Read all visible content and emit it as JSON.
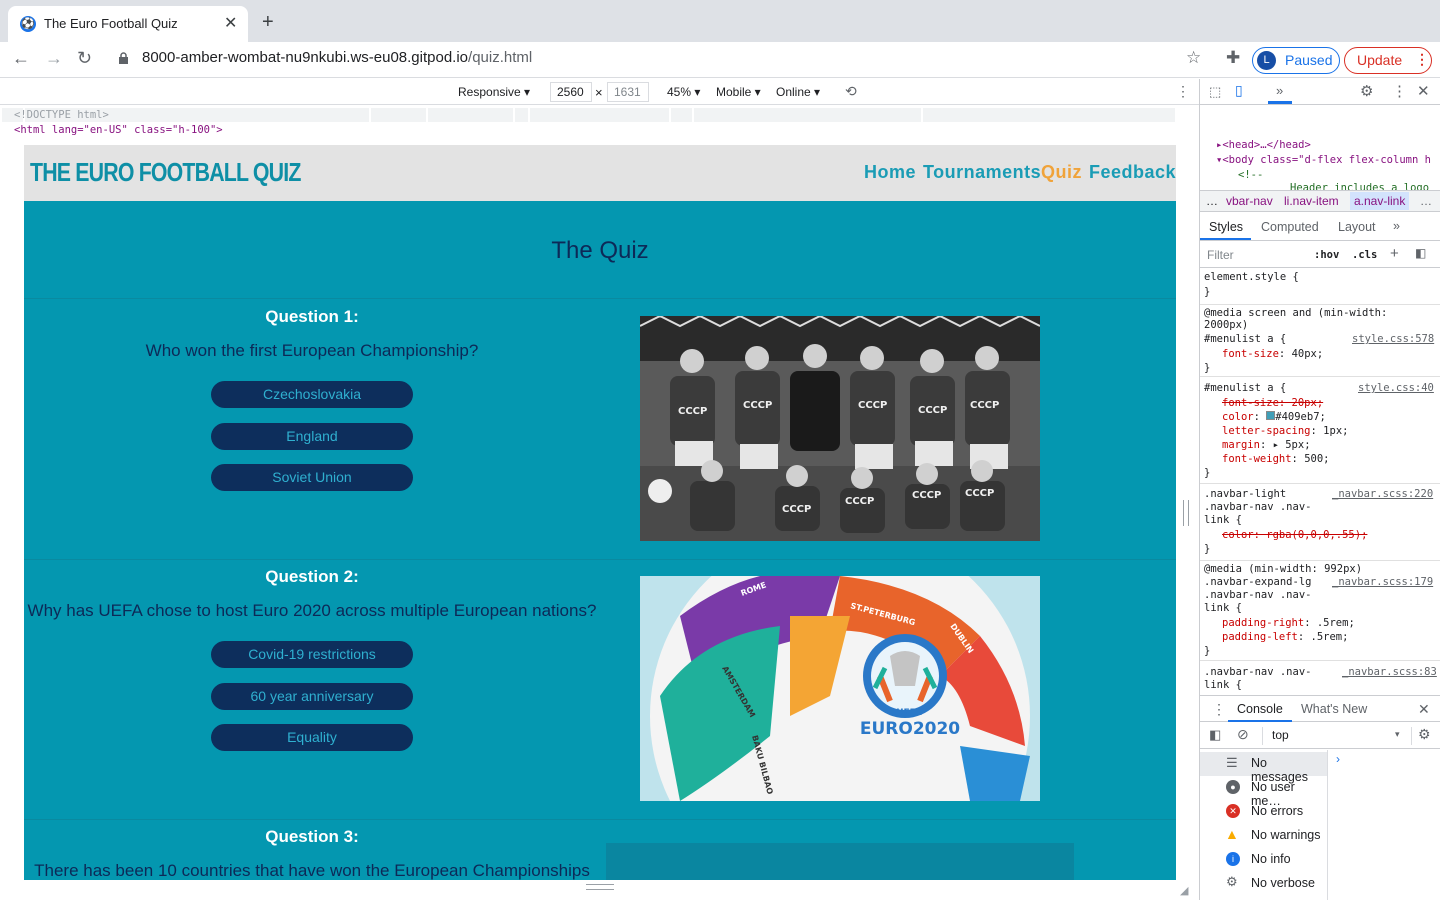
{
  "browser": {
    "tab_title": "The Euro Football Quiz",
    "new_tab": "+",
    "tab_close": "✕",
    "url_host": "8000-amber-wombat-nu9nkubi.ws-eu08.gitpod.io",
    "url_path": "/quiz.html",
    "profile_initial": "L",
    "profile_status": "Paused",
    "update_label": "Update"
  },
  "device_toolbar": {
    "mode": "Responsive ▾",
    "width": "2560",
    "times": "×",
    "height": "1631",
    "zoom": "45% ▾",
    "device_type": "Mobile ▾",
    "throttle": "Online ▾"
  },
  "site": {
    "brand": "THE EURO FOOTBALL QUIZ",
    "nav": [
      "Home",
      "Tournaments",
      "Quiz",
      "Feedback"
    ],
    "active_nav": "Quiz",
    "heading": "The Quiz",
    "questions": [
      {
        "title": "Question 1:",
        "text": "Who won the first European Championship?",
        "answers": [
          "Czechoslovakia",
          "England",
          "Soviet Union"
        ]
      },
      {
        "title": "Question 2:",
        "text": "Why has UEFA chose to host Euro 2020 across multiple European nations?",
        "answers": [
          "Covid-19 restrictions",
          "60 year anniversary",
          "Equality"
        ]
      },
      {
        "title": "Question 3:",
        "text": "There has been 10 countries that have won the European Championships"
      }
    ],
    "image_labels": {
      "team_shirt": "СССР",
      "ball_logo_top": "UEFA",
      "ball_logo": "EURO2020",
      "ball_cities": [
        "ROME",
        "ST.PETERBURG",
        "DUBLIN",
        "AMSTERDAM",
        "BAKU BILBAO"
      ]
    },
    "colors": {
      "page_bg": "#0497b0",
      "nav_link": "#1a9cb5",
      "nav_active": "#f0a33a",
      "answer_bg": "#0d2e5c"
    }
  },
  "devtools": {
    "elements": [
      "<!DOCTYPE html>",
      "<html lang=\"en-US\" class=\"h-100\">",
      "▸<head>…</head>",
      "▾<body class=\"d-flex flex-column h",
      "<!--",
      "Header includes a logo"
    ],
    "breadcrumbs": [
      "…",
      "vbar-nav",
      "li.nav-item",
      "a.nav-link",
      "…"
    ],
    "panel_tabs": [
      "Styles",
      "Computed",
      "Layout",
      "»"
    ],
    "filter_placeholder": "Filter",
    "hov": ":hov",
    "cls": ".cls",
    "element_style": "element.style {",
    "close_brace": "}",
    "media1": "@media screen and (min-width:",
    "media1b": "2000px)",
    "menulist_a": "#menulist a {",
    "src_578": "style.css:578",
    "src_40": "style.css:40",
    "fs40_prop": "font-size",
    "fs40_val": "40px;",
    "fs20": "font-size: 20px;",
    "color_prop": "color",
    "color_val": "#409eb7;",
    "ls_prop": "letter-spacing",
    "ls_val": "1px;",
    "margin_prop": "margin",
    "margin_val": "▸ 5px;",
    "fw_prop": "font-weight",
    "fw_val": "500;",
    "navbar_light": ".navbar-light",
    "navbar_light2": ".navbar-nav .nav-",
    "navbar_light3": "link {",
    "src_220": "_navbar.scss:220",
    "rgba": "color: rgba(0,0,0,.55);",
    "media2": "@media (min-width: 992px)",
    "expand1": ".navbar-expand-lg",
    "expand2": ".navbar-nav .nav-",
    "expand3": "link {",
    "src_179": "_navbar.scss:179",
    "pr_prop": "padding-right",
    "pr_val": ".5rem;",
    "pl_prop": "padding-left",
    "pl_val": ".5rem;",
    "last1": ".navbar-nav .nav-",
    "last2": "link {",
    "src_83": "_navbar.scss:83",
    "console_tabs": [
      "Console",
      "What's New"
    ],
    "context": "top",
    "messages": [
      {
        "label": "No messages",
        "icon": "list-icon",
        "color": "#5f6368"
      },
      {
        "label": "No user me…",
        "icon": "user-icon",
        "color": "#5f6368"
      },
      {
        "label": "No errors",
        "icon": "error-icon",
        "color": "#d93025"
      },
      {
        "label": "No warnings",
        "icon": "warning-icon",
        "color": "#f9ab00"
      },
      {
        "label": "No info",
        "icon": "info-icon",
        "color": "#1a73e8"
      },
      {
        "label": "No verbose",
        "icon": "verbose-icon",
        "color": "#5f6368"
      }
    ]
  }
}
